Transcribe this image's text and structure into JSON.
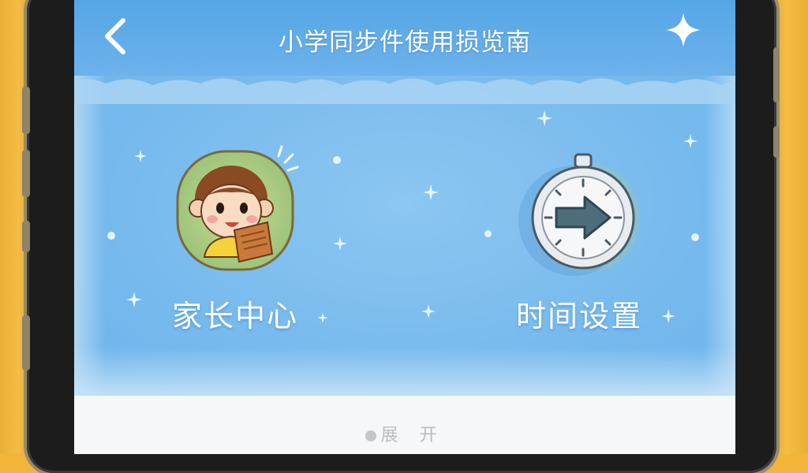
{
  "header": {
    "title": "小学同步件使用损览南",
    "back_icon": "chevron-left-icon",
    "action_icon": "sparkle-icon"
  },
  "features": [
    {
      "label": "家长中心",
      "icon": "child-reading-icon"
    },
    {
      "label": "时间设置",
      "icon": "stopwatch-arrow-icon"
    }
  ],
  "footer": {
    "text": "展 开"
  },
  "colors": {
    "header_blue": "#55a6e6",
    "panel_blue": "#79bbee",
    "text_white": "#ffffff",
    "footer_bg": "#f6f7f9"
  }
}
